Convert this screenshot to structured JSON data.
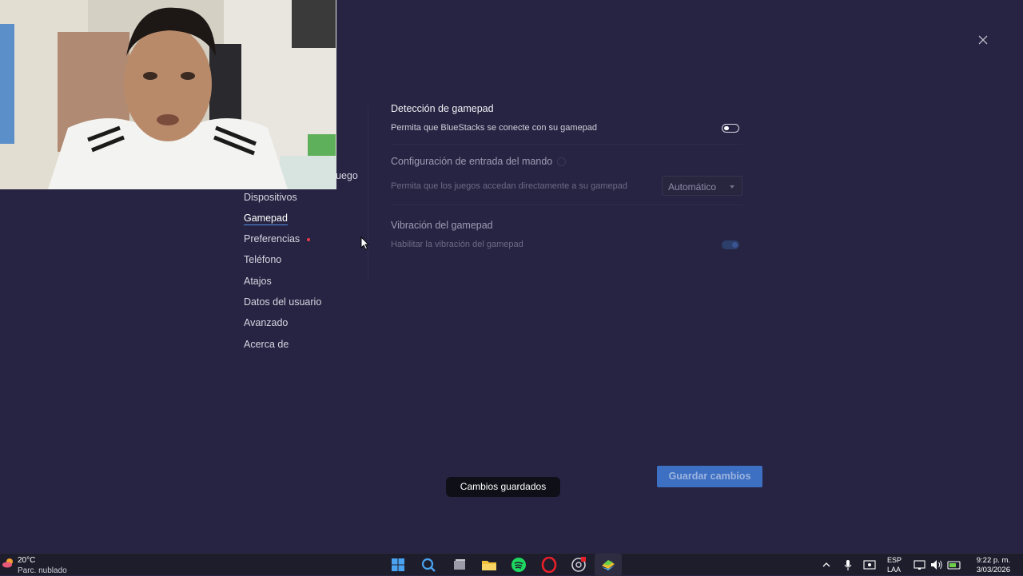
{
  "settings_nav": {
    "partial_item": "uego",
    "items": [
      {
        "label": "Dispositivos",
        "active": false,
        "badge": false
      },
      {
        "label": "Gamepad",
        "active": true,
        "badge": false
      },
      {
        "label": "Preferencias",
        "active": false,
        "badge": true
      },
      {
        "label": "Teléfono",
        "active": false,
        "badge": false
      },
      {
        "label": "Atajos",
        "active": false,
        "badge": false
      },
      {
        "label": "Datos del usuario",
        "active": false,
        "badge": false
      },
      {
        "label": "Avanzado",
        "active": false,
        "badge": false
      },
      {
        "label": "Acerca de",
        "active": false,
        "badge": false
      }
    ]
  },
  "gamepad_settings": {
    "detection": {
      "title": "Detección de gamepad",
      "description": "Permita que BlueStacks se conecte con su gamepad",
      "enabled": false
    },
    "input_config": {
      "title": "Configuración de entrada del mando",
      "description": "Permita que los juegos accedan directamente a su gamepad",
      "select_value": "Automático"
    },
    "vibration": {
      "title": "Vibración del gamepad",
      "description": "Habilitar la vibración del gamepad",
      "enabled": true
    }
  },
  "save_button": "Guardar cambios",
  "toast": "Cambios guardados",
  "taskbar": {
    "weather_temp": "20°C",
    "weather_condition": "Parc. nublado",
    "language_top": "ESP",
    "language_bottom": "LAA",
    "time": "9:22 p. m.",
    "date": "3/03/2026",
    "apps": [
      "start-icon",
      "search-icon",
      "file-explorer-icon",
      "folder-icon",
      "spotify-icon",
      "opera-icon",
      "chrome-icon",
      "bluestacks-icon"
    ]
  },
  "colors": {
    "background": "#262442",
    "accent": "#3d6fc2",
    "badge": "#e83a4a"
  }
}
